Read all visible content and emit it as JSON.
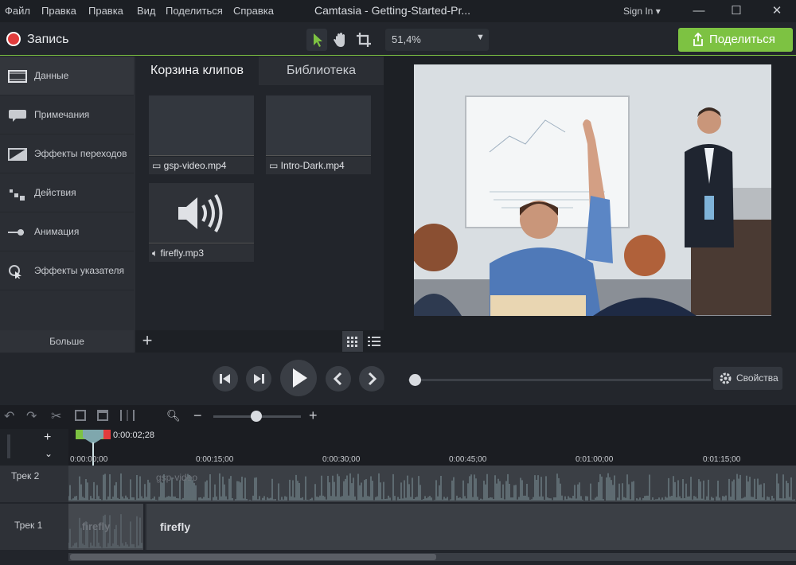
{
  "menu": [
    "Файл",
    "Правка",
    "Правка",
    "Вид",
    "Поделиться",
    "Справка"
  ],
  "window": {
    "title": "Camtasia - Getting-Started-Pr...",
    "signin": "Sign In ▾",
    "minimize": "—",
    "maximize": "☐",
    "close": "✕"
  },
  "toolbar": {
    "record": "Запись",
    "zoom": "51,4%",
    "share": "Поделиться"
  },
  "tools": [
    {
      "label": "Данные",
      "icon": "media-icon"
    },
    {
      "label": "Примечания",
      "icon": "annotation-icon"
    },
    {
      "label": "Эффекты переходов",
      "icon": "transition-icon"
    },
    {
      "label": "Действия",
      "icon": "behavior-icon"
    },
    {
      "label": "Анимация",
      "icon": "animation-icon"
    },
    {
      "label": "Эффекты указателя",
      "icon": "cursor-effect-icon"
    }
  ],
  "more": "Больше",
  "bin": {
    "tab_active": "Корзина клипов",
    "tab_library": "Библиотека",
    "clips": [
      {
        "name": "gsp-video.mp4",
        "kind": "video"
      },
      {
        "name": "Intro-Dark.mp4",
        "kind": "video"
      },
      {
        "name": "firefly.mp3",
        "kind": "audio"
      }
    ]
  },
  "player": {
    "properties": "Свойства",
    "progress": 0.0
  },
  "timeline": {
    "playhead": "0:00:02;28",
    "ticks": [
      "0:00:00;00",
      "0:00:15;00",
      "0:00:30;00",
      "0:00:45;00",
      "0:01:00;00",
      "0:01:15;00"
    ],
    "tracks": [
      {
        "label": "Трек 2",
        "clip": "gsp-video"
      },
      {
        "label": "Трек 1",
        "clip_a": "firefly",
        "clip_b": "firefly"
      }
    ],
    "zoom_level": 0.53
  },
  "colors": {
    "accent": "#7dc242",
    "record": "#e23c3c"
  }
}
